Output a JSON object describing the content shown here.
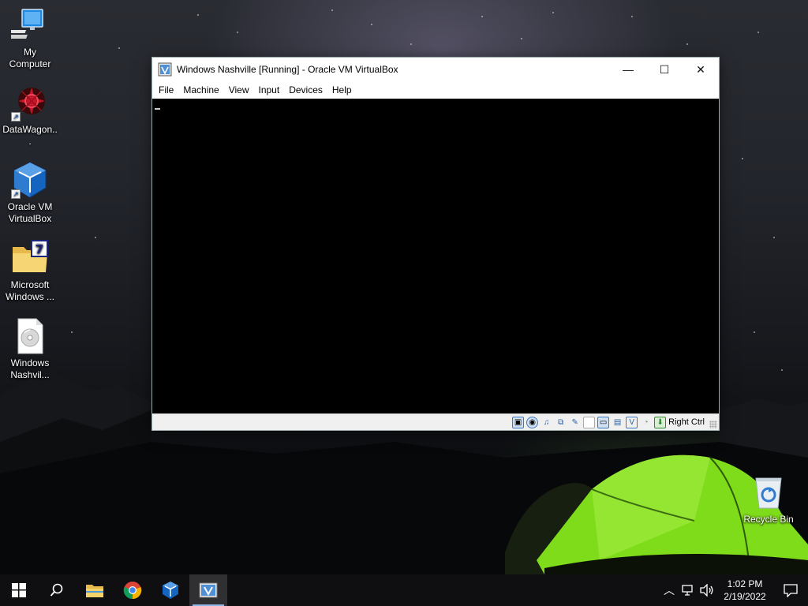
{
  "desktop": {
    "icons": [
      {
        "label": "My Computer",
        "icon": "computer-icon"
      },
      {
        "label": "DataWagon...",
        "icon": "datawagon-icon"
      },
      {
        "label": "Oracle VM VirtualBox",
        "icon": "virtualbox-icon"
      },
      {
        "label": "Microsoft Windows ...",
        "icon": "folder-icon"
      },
      {
        "label": "Windows Nashvil...",
        "icon": "disc-image-icon"
      },
      {
        "label": "Recycle Bin",
        "icon": "recycle-bin-icon"
      }
    ]
  },
  "vbox_window": {
    "title": "Windows Nashville [Running] - Oracle VM VirtualBox",
    "menu": [
      "File",
      "Machine",
      "View",
      "Input",
      "Devices",
      "Help"
    ],
    "controls": {
      "minimize": "—",
      "maximize": "☐",
      "close": "✕"
    },
    "status_icons": [
      "hard-disk-icon",
      "optical-drive-icon",
      "audio-icon",
      "network-icon",
      "usb-icon",
      "shared-folders-icon",
      "display-icon",
      "recording-icon",
      "cpu-icon",
      "mouse-integration-icon",
      "keyboard-icon"
    ],
    "host_key": "Right Ctrl"
  },
  "taskbar": {
    "apps": [
      {
        "name": "start-button"
      },
      {
        "name": "search-button"
      },
      {
        "name": "file-explorer"
      },
      {
        "name": "chrome"
      },
      {
        "name": "virtualbox"
      },
      {
        "name": "windows-nashville-vm",
        "active": true
      }
    ],
    "clock": {
      "time": "1:02 PM",
      "date": "2/19/2022"
    }
  },
  "colors": {
    "taskbar": "#101012",
    "accent": "#8fb6e6",
    "tent": "#7fdc1a"
  }
}
